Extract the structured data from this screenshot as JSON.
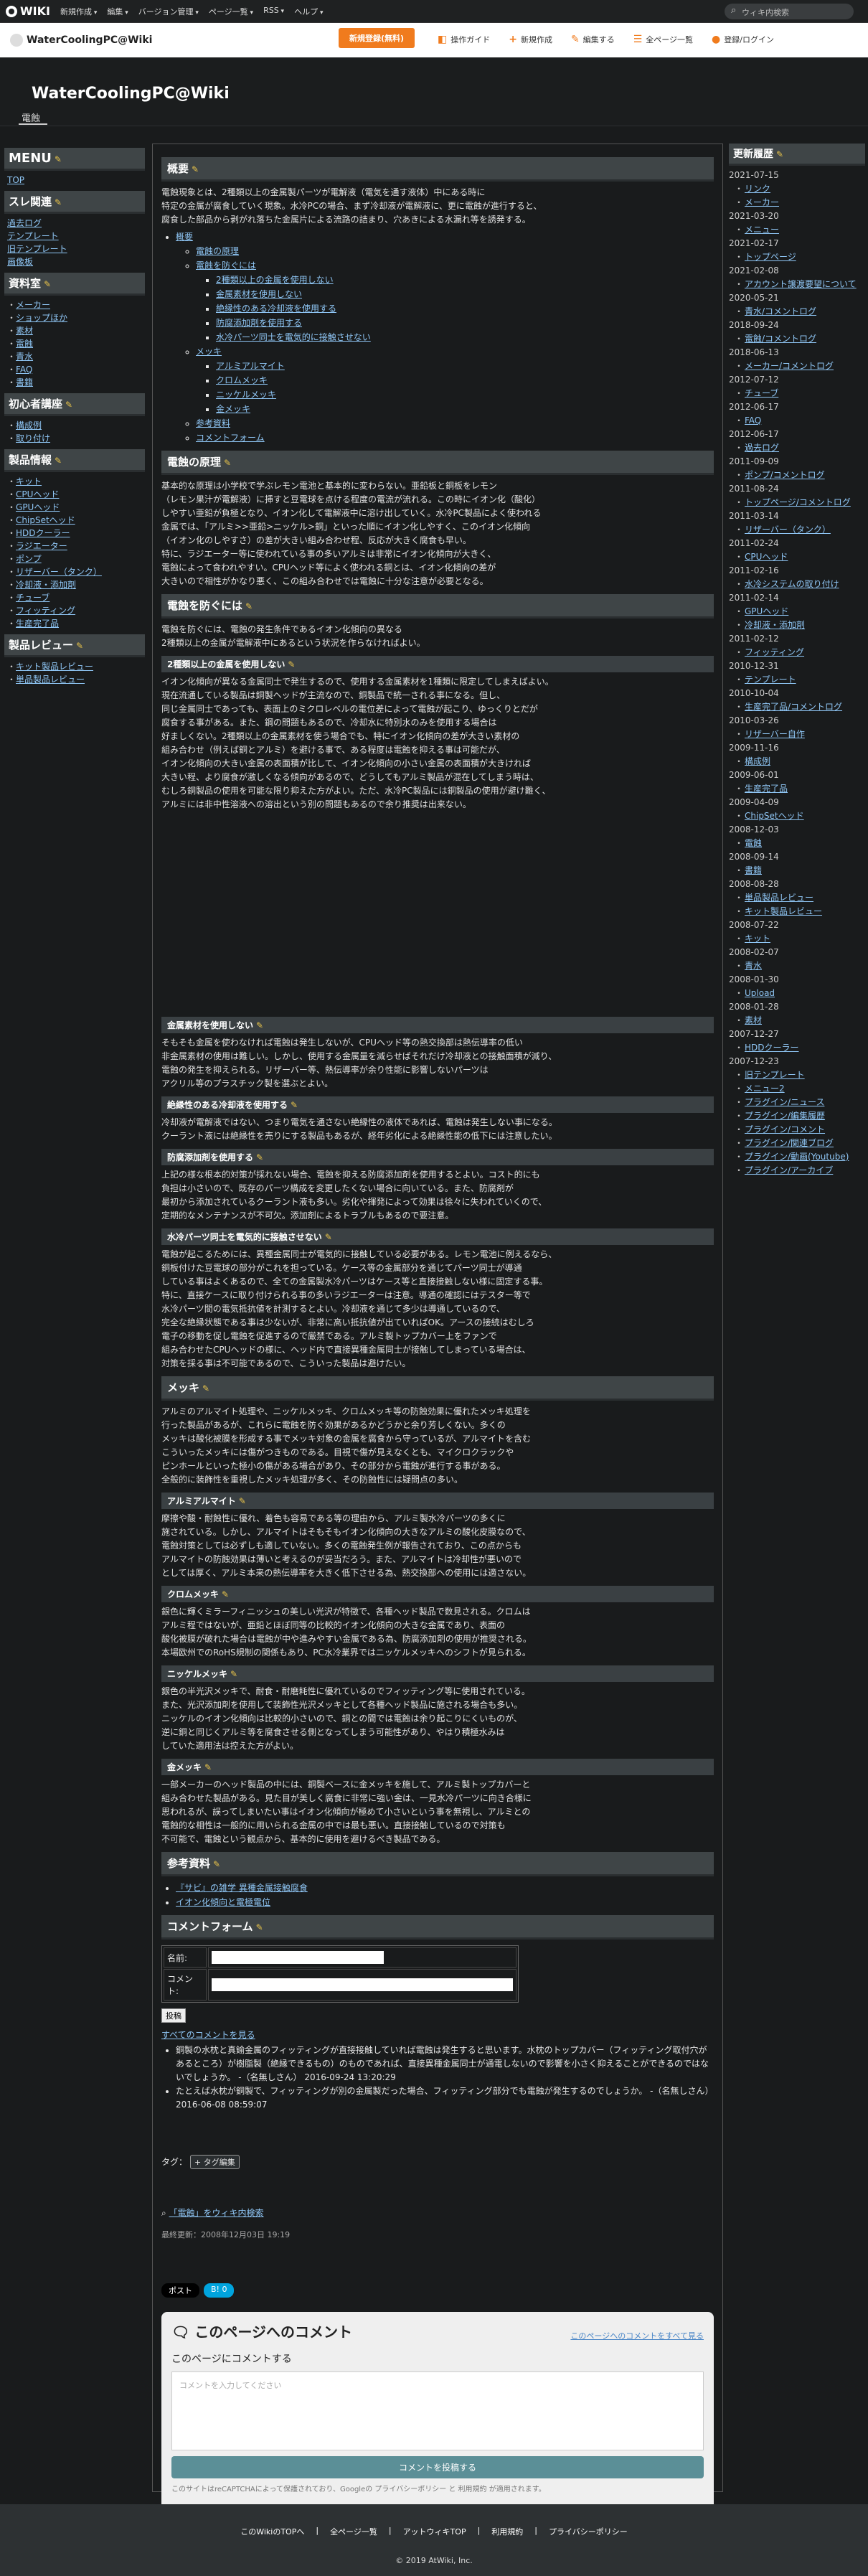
{
  "global_bar": {
    "logo_text": "WIKI",
    "menus": [
      "新規作成",
      "編集",
      "バージョン管理",
      "ページ一覧",
      "RSS",
      "ヘルプ"
    ],
    "search_placeholder": "ウィキ内検索"
  },
  "wiki_bar": {
    "wiki_name": "WaterCoolingPC@Wiki",
    "signup_label": "新規登録(無料)",
    "actions": [
      "操作ガイド",
      "新規作成",
      "編集する",
      "全ページ一覧",
      "登録/ログイン"
    ]
  },
  "site": {
    "title": "WaterCoolingPC@Wiki",
    "breadcrumb": "電蝕"
  },
  "left_menu": [
    {
      "title": "MENU",
      "items": [
        {
          "text": "TOP",
          "indent": false
        }
      ]
    },
    {
      "title": "スレ関連",
      "items": [
        {
          "text": "過去ログ",
          "indent": false
        },
        {
          "text": "テンプレート",
          "indent": false
        },
        {
          "text": "旧テンプレート",
          "indent": false
        },
        {
          "text": "画像板",
          "indent": false
        }
      ]
    },
    {
      "title": "資料室",
      "items": [
        {
          "text": "メーカー",
          "indent": true
        },
        {
          "text": "ショップほか",
          "indent": true
        },
        {
          "text": "素材",
          "indent": true
        },
        {
          "text": "電蝕",
          "indent": true
        },
        {
          "text": "青水",
          "indent": true
        },
        {
          "text": "FAQ",
          "indent": true
        },
        {
          "text": "書籍",
          "indent": true
        }
      ]
    },
    {
      "title": "初心者講座",
      "items": [
        {
          "text": "構成例",
          "indent": true
        },
        {
          "text": "取り付け",
          "indent": true
        }
      ]
    },
    {
      "title": "製品情報",
      "items": [
        {
          "text": "キット",
          "indent": true
        },
        {
          "text": "CPUヘッド",
          "indent": true
        },
        {
          "text": "GPUヘッド",
          "indent": true
        },
        {
          "text": "ChipSetヘッド",
          "indent": true
        },
        {
          "text": "HDDクーラー",
          "indent": true
        },
        {
          "text": "ラジエーター",
          "indent": true
        },
        {
          "text": "ポンプ",
          "indent": true
        },
        {
          "text": "リザーバー（タンク）",
          "indent": true
        },
        {
          "text": "冷却液・添加剤",
          "indent": true
        },
        {
          "text": "チューブ",
          "indent": true
        },
        {
          "text": "フィッティング",
          "indent": true
        },
        {
          "text": "生産完了品",
          "indent": true
        }
      ]
    },
    {
      "title": "製品レビュー",
      "items": [
        {
          "text": "キット製品レビュー",
          "indent": true
        },
        {
          "text": "単品製品レビュー",
          "indent": true
        }
      ]
    }
  ],
  "main": {
    "overview_title": "概要",
    "intro": "電蝕現象とは、2種類以上の金属製パーツが電解液（電気を通す液体）中にある時に\n特定の金属が腐食していく現象。水冷PCの場合、まず冷却液が電解液に、更に電蝕が進行すると、\n腐食した部品から剥がれ落ちた金属片による流路の詰まり、穴あきによる水漏れ等を誘発する。",
    "toc": {
      "root": "概要",
      "l1": [
        "電蝕の原理",
        "電蝕を防ぐには"
      ],
      "l2_prevent": [
        "2種類以上の金属を使用しない",
        "金属素材を使用しない",
        "絶縁性のある冷却液を使用する",
        "防腐添加剤を使用する",
        "水冷パーツ同士を電気的に接触させない"
      ],
      "mekki": "メッキ",
      "l2_mekki": [
        "アルミアルマイト",
        "クロムメッキ",
        "ニッケルメッキ",
        "金メッキ"
      ],
      "refs": "参考資料",
      "form": "コメントフォーム"
    },
    "principle_title": "電蝕の原理",
    "principle_text": "基本的な原理は小学校で学ぶレモン電池と基本的に変わらない。亜鉛板と銅板をレモン\n（レモン果汁が電解液）に挿すと豆電球を点ける程度の電流が流れる。この時にイオン化（酸化）\nしやすい亜鉛が負極となり、イオン化して電解液中に溶け出していく。水冷PC製品によく使われる\n金属では、「アルミ>>亜鉛>ニッケル>銅」といった順にイオン化しやすく、このイオン化傾向\n（イオン化のしやすさ）の差が大きい組み合わせ程、反応が大きく腐食も早い。\n特に、ラジエーター等に使われている事の多いアルミは非常にイオン化傾向が大きく、\n電蝕によって食われやすい。CPUヘッド等によく使われる銅とは、イオン化傾向の差が\n大きいので相性がかなり悪く、この組み合わせでは電蝕に十分な注意が必要となる。",
    "prevent_title": "電蝕を防ぐには",
    "prevent_text": "電蝕を防ぐには、電蝕の発生条件であるイオン化傾向の異なる\n2種類以上の金属が電解液中にあるという状況を作らなければよい。",
    "sub1_title": "2種類以上の金属を使用しない",
    "sub1_text": "イオン化傾向が異なる金属同士で発生するので、使用する金属素材を1種類に限定してしまえばよい。\n現在流通している製品は銅製ヘッドが主流なので、銅製品で統一される事になる。但し、\n同じ金属同士であっても、表面上のミクロレベルの電位差によって電蝕が起こり、ゆっくりとだが\n腐食する事がある。また、鋼の問題もあるので、冷却水に特別水のみを使用する場合は\n好ましくない。2種類以上の金属素材を使う場合でも、特にイオン化傾向の差が大きい素材の\n組み合わせ（例えば銅とアルミ）を避ける事で、ある程度は電蝕を抑える事は可能だが、\nイオン化傾向の大きい金属の表面積が比して、イオン化傾向の小さい金属の表面積が大きければ\n大きい程、より腐食が激しくなる傾向があるので、どうしてもアルミ製品が混在してしまう時は、\nむしろ銅製品の使用を可能な限り抑えた方がよい。ただ、水冷PC製品には銅製品の使用が避け難く、\nアルミには非中性溶液への溶出という別の問題もあるので余り推奨は出来ない。",
    "sub2_title": "金属素材を使用しない",
    "sub2_text": "そもそも金属を使わなければ電蝕は発生しないが、CPUヘッド等の熱交換部は熱伝導率の低い\n非金属素材の使用は難しい。しかし、使用する金属量を減らせばそれだけ冷却液との接触面積が減り、\n電蝕の発生を抑えられる。リザーバー等、熱伝導率が余り性能に影響しないパーツは\nアクリル等のプラスチック製を選ぶとよい。",
    "sub3_title": "絶縁性のある冷却液を使用する",
    "sub3_text": "冷却液が電解液ではない、つまり電気を通さない絶縁性の液体であれば、電蝕は発生しない事になる。\nクーラント液には絶縁性を売りにする製品もあるが、経年劣化による絶縁性能の低下には注意したい。",
    "sub3_link": "クーラント液",
    "sub4_title": "防腐添加剤を使用する",
    "sub4_text": "上記の様な根本的対策が採れない場合、電蝕を抑える防腐添加剤を使用するとよい。コスト的にも\n負担は小さいので、既存のパーツ構成を変更したくない場合に向いている。また、防腐剤が\n最初から添加されているクーラント液も多い。劣化や揮発によって効果は徐々に失われていくので、\n定期的なメンテナンスが不可欠。添加剤によるトラブルもあるので要注意。",
    "sub4_link": "防腐添加剤",
    "sub5_title": "水冷パーツ同士を電気的に接触させない",
    "sub5_text": "電蝕が起こるためには、異種金属同士が電気的に接触している必要がある。レモン電池に例えるなら、\n銅板付けた豆電球の部分がこれを担っている。ケース等の金属部分を通じてパーツ同士が導通\nしている事はよくあるので、全ての金属製水冷パーツはケース等と直接接触しない様に固定する事。\n特に、直接ケースに取り付けられる事の多いラジエーターは注意。導通の確認にはテスター等で\n水冷パーツ間の電気抵抗値を計測するとよい。冷却液を通じて多少は導通しているので、\n完全な絶縁状態である事は少ないが、非常に高い抵抗値が出ていればOK。アースの接続はむしろ\n電子の移動を促し電蝕を促進するので厳禁である。アルミ製トップカバー上をファンで\n組み合わせたCPUヘッドの様に、ヘッド内で直接異種金属同士が接触してしまっている場合は、\n対策を採る事は不可能であるので、こういった製品は避けたい。",
    "mekki_title": "メッキ",
    "mekki_text": "アルミのアルマイト処理や、ニッケルメッキ、クロムメッキ等の防蝕効果に優れたメッキ処理を\n行った製品があるが、これらに電蝕を防ぐ効果があるかどうかと余り芳しくない。多くの\nメッキは酸化被膜を形成する事でメッキ対象の金属を腐食から守っているが、アルマイトを含む\nこういったメッキには傷がつきものである。目視で傷が見えなくとも、マイクロクラックや\nピンホールといった極小の傷がある場合があり、その部分から電蝕が進行する事がある。\n全般的に装飾性を重視したメッキ処理が多く、その防蝕性には疑問点の多い。",
    "alumite_title": "アルミアルマイト",
    "alumite_text": "摩擦や酸・耐蝕性に優れ、着色も容易である等の理由から、アルミ製水冷パーツの多くに\n施されている。しかし、アルマイトはそもそもイオン化傾向の大きなアルミの酸化皮膜なので、\n電蝕対策としては必ずしも適していない。多くの電蝕発生例が報告されており、この点からも\nアルマイトの防蝕効果は薄いと考えるのが妥当だろう。また、アルマイトは冷却性が悪いので\nとしては厚く、アルミ本来の熱伝導率を大きく低下させる為、熱交換部への使用には適さない。",
    "chrome_title": "クロムメッキ",
    "chrome_text": "銀色に輝くミラーフィニッシュの美しい光沢が特徴で、各種ヘッド製品で数見される。クロムは\nアルミ程ではないが、亜鉛とほぼ同等の比較的イオン化傾向の大きな金属であり、表面の\n酸化被膜が破れた場合は電蝕が中や進みやすい金属である為、防腐添加剤の使用が推奨される。\n本場欧州でのRoHS規制の関係もあり、PC水冷業界ではニッケルメッキへのシフトが見られる。",
    "nickel_title": "ニッケルメッキ",
    "nickel_text": "銀色の半光沢メッキで、耐食・耐磨耗性に優れているのでフィッティング等に使用されている。\nまた、光沢添加剤を使用して装飾性光沢メッキとして各種ヘッド製品に施される場合も多い。\nニッケルのイオン化傾向は比較的小さいので、銅との間では電蝕は余り起こりにくいものが、\n逆に銅と同じくアルミ等を腐食させる側となってしまう可能性があり、やはり積極水みは\nしていた適用法は控えた方がよい。",
    "gold_title": "金メッキ",
    "gold_text": "一部メーカーのヘッド製品の中には、銅製ベースに金メッキを施して、アルミ製トップカバーと\n組み合わせた製品がある。見た目が美しく腐食に非常に強い金は、一見水冷パーツに向き合様に\n思われるが、誤ってしまいたい事はイオン化傾向が極めて小さいという事を無視し、アルミとの\n電蝕的な相性は一般的に用いられる金属の中では最も悪い。直接接触しているので対策も\n不可能で、電蝕という観点から、基本的に使用を避けるべき製品である。",
    "refs_title": "参考資料",
    "refs": [
      "『サビ』の雑学 異種金属接触腐食",
      "イオン化傾向と電極電位"
    ],
    "form_title": "コメントフォーム",
    "form_name_label": "名前:",
    "form_comment_label": "コメント:",
    "form_submit": "投稿",
    "show_all": "すべてのコメントを見る",
    "comments": [
      "銅製の水枕と真鍮金属のフィッティングが直接接触していれば電蝕は発生すると思います。水枕のトップカバー（フィッティング取付穴があるところ）が樹脂製（絶縁できるもの）のものであれば、直接異種金属同士が通電しないので影響を小さく抑えることができるのではないでしょうか。 -（名無しさん） 2016-09-24 13:20:29",
      "たとえば水枕が銅製で、フィッティングが別の金属製だった場合、フィッティング部分でも電蝕が発生するのでしょうか。 -（名無しさん） 2016-06-08 08:59:07"
    ],
    "tag_label": "タグ：",
    "tag_button": "+ タグ編集",
    "search_link": "「電蝕」をウィキ内検索",
    "last_updated": "最終更新：2008年12月03日 19:19",
    "share_x": "ポスト",
    "share_b": "B! 0",
    "cbox_title": "このページへのコメント",
    "cbox_all": "このページへのコメントをすべて見る",
    "cbox_label": "このページにコメントする",
    "cbox_placeholder": "コメントを入力してください",
    "cbox_submit": "コメントを投稿する",
    "cbox_note": "このサイトはreCAPTCHAによって保護されており、Googleの プライバシーポリシー と 利用規約 が適用されます。"
  },
  "history": {
    "title": "更新履歴",
    "entries": [
      {
        "date": "2021-07-15",
        "items": [
          "リンク",
          "メーカー"
        ]
      },
      {
        "date": "2021-03-20",
        "items": [
          "メニュー"
        ]
      },
      {
        "date": "2021-02-17",
        "items": [
          "トップページ"
        ]
      },
      {
        "date": "2021-02-08",
        "items": [
          "アカウント譲渡要望について"
        ]
      },
      {
        "date": "2020-05-21",
        "items": [
          "青水/コメントログ"
        ]
      },
      {
        "date": "2018-09-24",
        "items": [
          "電蝕/コメントログ"
        ]
      },
      {
        "date": "2018-06-13",
        "items": [
          "メーカー/コメントログ"
        ]
      },
      {
        "date": "2012-07-12",
        "items": [
          "チューブ"
        ]
      },
      {
        "date": "2012-06-17",
        "items": [
          "FAQ"
        ]
      },
      {
        "date": "2012-06-17",
        "items": [
          "過去ログ"
        ]
      },
      {
        "date": "2011-09-09",
        "items": [
          "ポンプ/コメントログ"
        ]
      },
      {
        "date": "2011-08-24",
        "items": [
          "トップページ/コメントログ"
        ]
      },
      {
        "date": "2011-03-14",
        "items": [
          "リザーバー（タンク）"
        ]
      },
      {
        "date": "2011-02-24",
        "items": [
          "CPUヘッド"
        ]
      },
      {
        "date": "2011-02-16",
        "items": [
          "水冷システムの取り付け"
        ]
      },
      {
        "date": "2011-02-14",
        "items": [
          "GPUヘッド",
          "冷却液・添加剤"
        ]
      },
      {
        "date": "2011-02-12",
        "items": [
          "フィッティング"
        ]
      },
      {
        "date": "2010-12-31",
        "items": [
          "テンプレート"
        ]
      },
      {
        "date": "2010-10-04",
        "items": [
          "生産完了品/コメントログ"
        ]
      },
      {
        "date": "2010-03-26",
        "items": [
          "リザーバー自作"
        ]
      },
      {
        "date": "2009-11-16",
        "items": [
          "構成例"
        ]
      },
      {
        "date": "2009-06-01",
        "items": [
          "生産完了品"
        ]
      },
      {
        "date": "2009-04-09",
        "items": [
          "ChipSetヘッド"
        ]
      },
      {
        "date": "2008-12-03",
        "items": [
          "電蝕"
        ]
      },
      {
        "date": "2008-09-14",
        "items": [
          "書籍"
        ]
      },
      {
        "date": "2008-08-28",
        "items": [
          "単品製品レビュー",
          "キット製品レビュー"
        ]
      },
      {
        "date": "2008-07-22",
        "items": [
          "キット"
        ]
      },
      {
        "date": "2008-02-07",
        "items": [
          "青水"
        ]
      },
      {
        "date": "2008-01-30",
        "items": [
          "Upload"
        ]
      },
      {
        "date": "2008-01-28",
        "items": [
          "素材"
        ]
      },
      {
        "date": "2007-12-27",
        "items": [
          "HDDクーラー"
        ]
      },
      {
        "date": "2007-12-23",
        "items": [
          "旧テンプレート",
          "メニュー2",
          "プラグイン/ニュース",
          "プラグイン/編集履歴",
          "プラグイン/コメント",
          "プラグイン/関連ブログ",
          "プラグイン/動画(Youtube)",
          "プラグイン/アーカイブ"
        ]
      }
    ]
  },
  "footer": {
    "links": [
      "このWikiのTOPへ",
      "全ページ一覧",
      "アットウィキTOP",
      "利用規約",
      "プライバシーポリシー"
    ],
    "copyright": "2019 AtWiki, Inc."
  }
}
